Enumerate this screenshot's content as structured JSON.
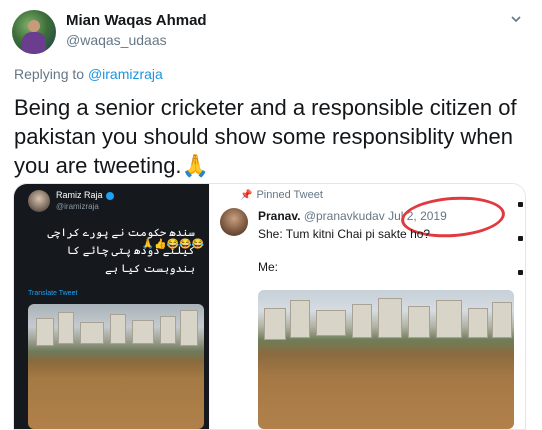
{
  "author": {
    "name": "Mian Waqas Ahmad",
    "handle": "@waqas_udaas"
  },
  "reply": {
    "prefix": "Replying to ",
    "mention": "@iramizraja"
  },
  "tweet": {
    "text": "Being a senior cricketer and a responsible citizen of pakistan you should show some responsiblity when you are tweeting.🙏"
  },
  "left_screenshot": {
    "name": "Ramiz Raja",
    "handle": "@iramizraja",
    "urdu_text": "سندھ حکومت نے پورے کراچی کیلئے دودھ پتی چائے کا بندوبست کیا ہے",
    "emojis": "😂😂😂👍🙏",
    "translate": "Translate Tweet"
  },
  "right_screenshot": {
    "pinned": "Pinned Tweet",
    "name": "Pranav.",
    "handle": "@pranavkudav",
    "date": "Jul 2, 2019",
    "line1": "She: Tum kitni Chai pi sakte ho?",
    "line2": "Me:"
  },
  "colors": {
    "link": "#1b95e0",
    "circle": "#e0393e"
  },
  "icons": {
    "caret": "chevron-down-icon",
    "pin": "pin-icon",
    "verified": "verified-badge-icon"
  }
}
